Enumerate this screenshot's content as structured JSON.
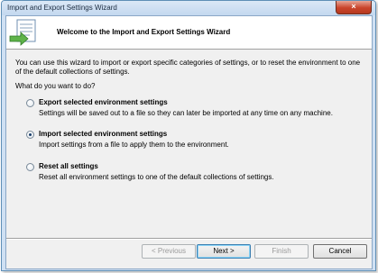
{
  "window": {
    "title": "Import and Export Settings Wizard",
    "close_label": "×"
  },
  "header": {
    "title": "Welcome to the Import and Export Settings Wizard",
    "icon": "wizard-settings-icon"
  },
  "intro": "You can use this wizard to import or export specific categories of settings, or to reset the environment to one of the default collections of settings.",
  "question": "What do you want to do?",
  "options": [
    {
      "label": "Export selected environment settings",
      "description": "Settings will be saved out to a file so they can later be imported at any time on any machine.",
      "selected": false
    },
    {
      "label": "Import selected environment settings",
      "description": "Import settings from a file to apply them to the environment.",
      "selected": true
    },
    {
      "label": "Reset all settings",
      "description": "Reset all environment settings to one of the default collections of settings.",
      "selected": false
    }
  ],
  "buttons": {
    "previous": "< Previous",
    "next": "Next >",
    "finish": "Finish",
    "cancel": "Cancel"
  },
  "colors": {
    "title_bar": "#c3d8ef",
    "close_button": "#c9442b",
    "client_bg": "#f0f0f0"
  }
}
